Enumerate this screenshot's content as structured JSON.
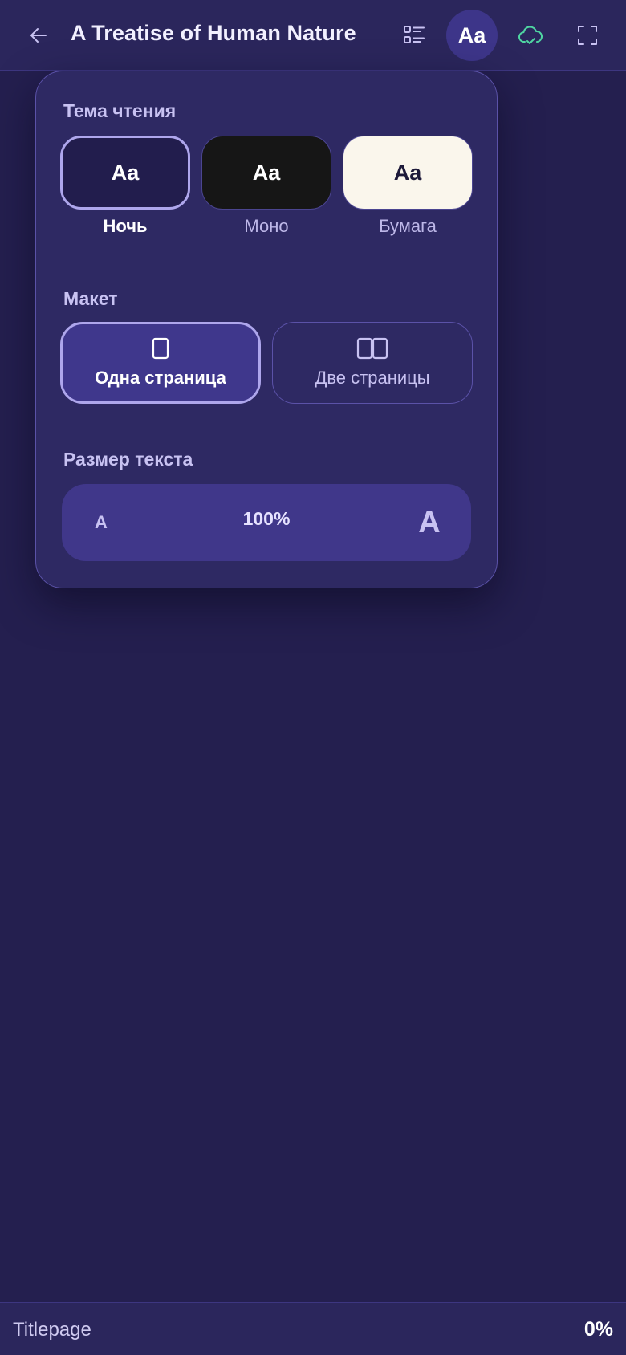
{
  "header": {
    "title": "A Treatise of Human Nature",
    "typography_label": "Aa",
    "icons": {
      "back": "arrow-left-icon",
      "toc": "list-icon",
      "sync": "cloud-check-icon",
      "fullscreen": "fullscreen-icon"
    },
    "sync_color": "#4fd6a2"
  },
  "settings": {
    "theme": {
      "title": "Тема чтения",
      "sample": "Aa",
      "options": [
        {
          "label": "Ночь",
          "selected": true
        },
        {
          "label": "Моно",
          "selected": false
        },
        {
          "label": "Бумага",
          "selected": false
        }
      ]
    },
    "layout": {
      "title": "Макет",
      "options": [
        {
          "label": "Одна страница",
          "icon": "single-page-icon",
          "selected": true
        },
        {
          "label": "Две страницы",
          "icon": "two-pages-icon",
          "selected": false
        }
      ]
    },
    "text_size": {
      "title": "Размер текста",
      "decrease": "A",
      "value": "100%",
      "increase": "A"
    }
  },
  "footer": {
    "chapter": "Titlepage",
    "progress": "0%"
  },
  "colors": {
    "background": "#241f4f",
    "panel": "#2e2963",
    "accent": "#aea6ec",
    "selected_fill": "#3f378c"
  }
}
